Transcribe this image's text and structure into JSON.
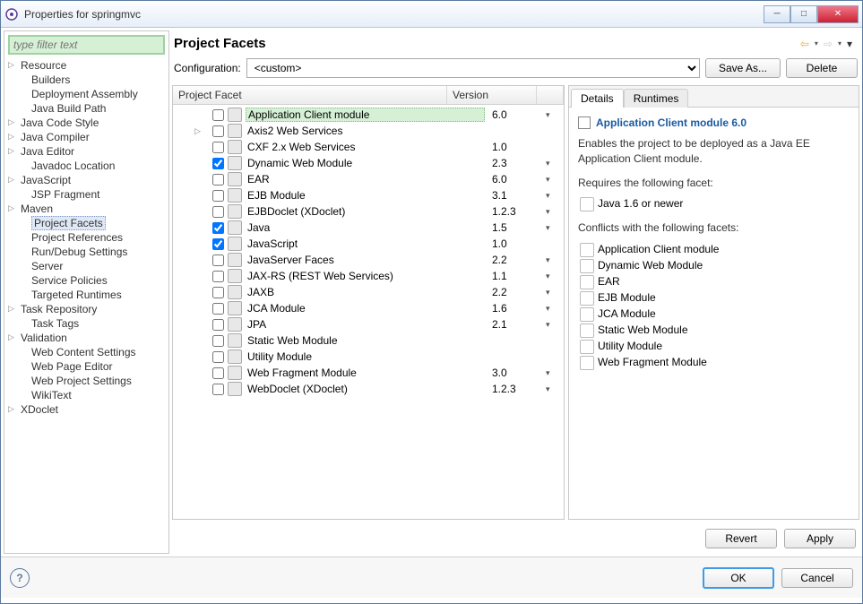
{
  "window": {
    "title": "Properties for springmvc"
  },
  "filter_placeholder": "type filter text",
  "tree": [
    {
      "label": "Resource",
      "expandable": true
    },
    {
      "label": "Builders",
      "child": true
    },
    {
      "label": "Deployment Assembly",
      "child": true
    },
    {
      "label": "Java Build Path",
      "child": true
    },
    {
      "label": "Java Code Style",
      "expandable": true
    },
    {
      "label": "Java Compiler",
      "expandable": true
    },
    {
      "label": "Java Editor",
      "expandable": true
    },
    {
      "label": "Javadoc Location",
      "child": true
    },
    {
      "label": "JavaScript",
      "expandable": true
    },
    {
      "label": "JSP Fragment",
      "child": true
    },
    {
      "label": "Maven",
      "expandable": true
    },
    {
      "label": "Project Facets",
      "child": true,
      "selected": true
    },
    {
      "label": "Project References",
      "child": true
    },
    {
      "label": "Run/Debug Settings",
      "child": true
    },
    {
      "label": "Server",
      "child": true
    },
    {
      "label": "Service Policies",
      "child": true
    },
    {
      "label": "Targeted Runtimes",
      "child": true
    },
    {
      "label": "Task Repository",
      "expandable": true
    },
    {
      "label": "Task Tags",
      "child": true
    },
    {
      "label": "Validation",
      "expandable": true
    },
    {
      "label": "Web Content Settings",
      "child": true
    },
    {
      "label": "Web Page Editor",
      "child": true
    },
    {
      "label": "Web Project Settings",
      "child": true
    },
    {
      "label": "WikiText",
      "child": true
    },
    {
      "label": "XDoclet",
      "expandable": true
    }
  ],
  "page_title": "Project Facets",
  "config_label": "Configuration:",
  "config_value": "<custom>",
  "btn_saveas": "Save As...",
  "btn_delete": "Delete",
  "table": {
    "col_facet": "Project Facet",
    "col_version": "Version",
    "rows": [
      {
        "checked": false,
        "name": "Application Client module",
        "version": "6.0",
        "dd": true,
        "indent": true,
        "selected": true
      },
      {
        "checked": false,
        "name": "Axis2 Web Services",
        "version": "",
        "dd": false,
        "indent": true,
        "exp": true
      },
      {
        "checked": false,
        "name": "CXF 2.x Web Services",
        "version": "1.0",
        "dd": false,
        "indent": true
      },
      {
        "checked": true,
        "name": "Dynamic Web Module",
        "version": "2.3",
        "dd": true,
        "indent": true
      },
      {
        "checked": false,
        "name": "EAR",
        "version": "6.0",
        "dd": true,
        "indent": true
      },
      {
        "checked": false,
        "name": "EJB Module",
        "version": "3.1",
        "dd": true,
        "indent": true
      },
      {
        "checked": false,
        "name": "EJBDoclet (XDoclet)",
        "version": "1.2.3",
        "dd": true,
        "indent": true
      },
      {
        "checked": true,
        "name": "Java",
        "version": "1.5",
        "dd": true,
        "indent": true
      },
      {
        "checked": true,
        "name": "JavaScript",
        "version": "1.0",
        "dd": false,
        "indent": true
      },
      {
        "checked": false,
        "name": "JavaServer Faces",
        "version": "2.2",
        "dd": true,
        "indent": true
      },
      {
        "checked": false,
        "name": "JAX-RS (REST Web Services)",
        "version": "1.1",
        "dd": true,
        "indent": true
      },
      {
        "checked": false,
        "name": "JAXB",
        "version": "2.2",
        "dd": true,
        "indent": true
      },
      {
        "checked": false,
        "name": "JCA Module",
        "version": "1.6",
        "dd": true,
        "indent": true
      },
      {
        "checked": false,
        "name": "JPA",
        "version": "2.1",
        "dd": true,
        "indent": true
      },
      {
        "checked": false,
        "name": "Static Web Module",
        "version": "",
        "dd": false,
        "indent": true
      },
      {
        "checked": false,
        "name": "Utility Module",
        "version": "",
        "dd": false,
        "indent": true
      },
      {
        "checked": false,
        "name": "Web Fragment Module",
        "version": "3.0",
        "dd": true,
        "indent": true
      },
      {
        "checked": false,
        "name": "WebDoclet (XDoclet)",
        "version": "1.2.3",
        "dd": true,
        "indent": true
      }
    ]
  },
  "tabs": {
    "details": "Details",
    "runtimes": "Runtimes"
  },
  "details": {
    "title": "Application Client module 6.0",
    "desc": "Enables the project to be deployed as a Java EE Application Client module.",
    "requires_label": "Requires the following facet:",
    "requires": [
      "Java 1.6 or newer"
    ],
    "conflicts_label": "Conflicts with the following facets:",
    "conflicts": [
      "Application Client module",
      "Dynamic Web Module",
      "EAR",
      "EJB Module",
      "JCA Module",
      "Static Web Module",
      "Utility Module",
      "Web Fragment Module"
    ]
  },
  "btn_revert": "Revert",
  "btn_apply": "Apply",
  "btn_ok": "OK",
  "btn_cancel": "Cancel"
}
